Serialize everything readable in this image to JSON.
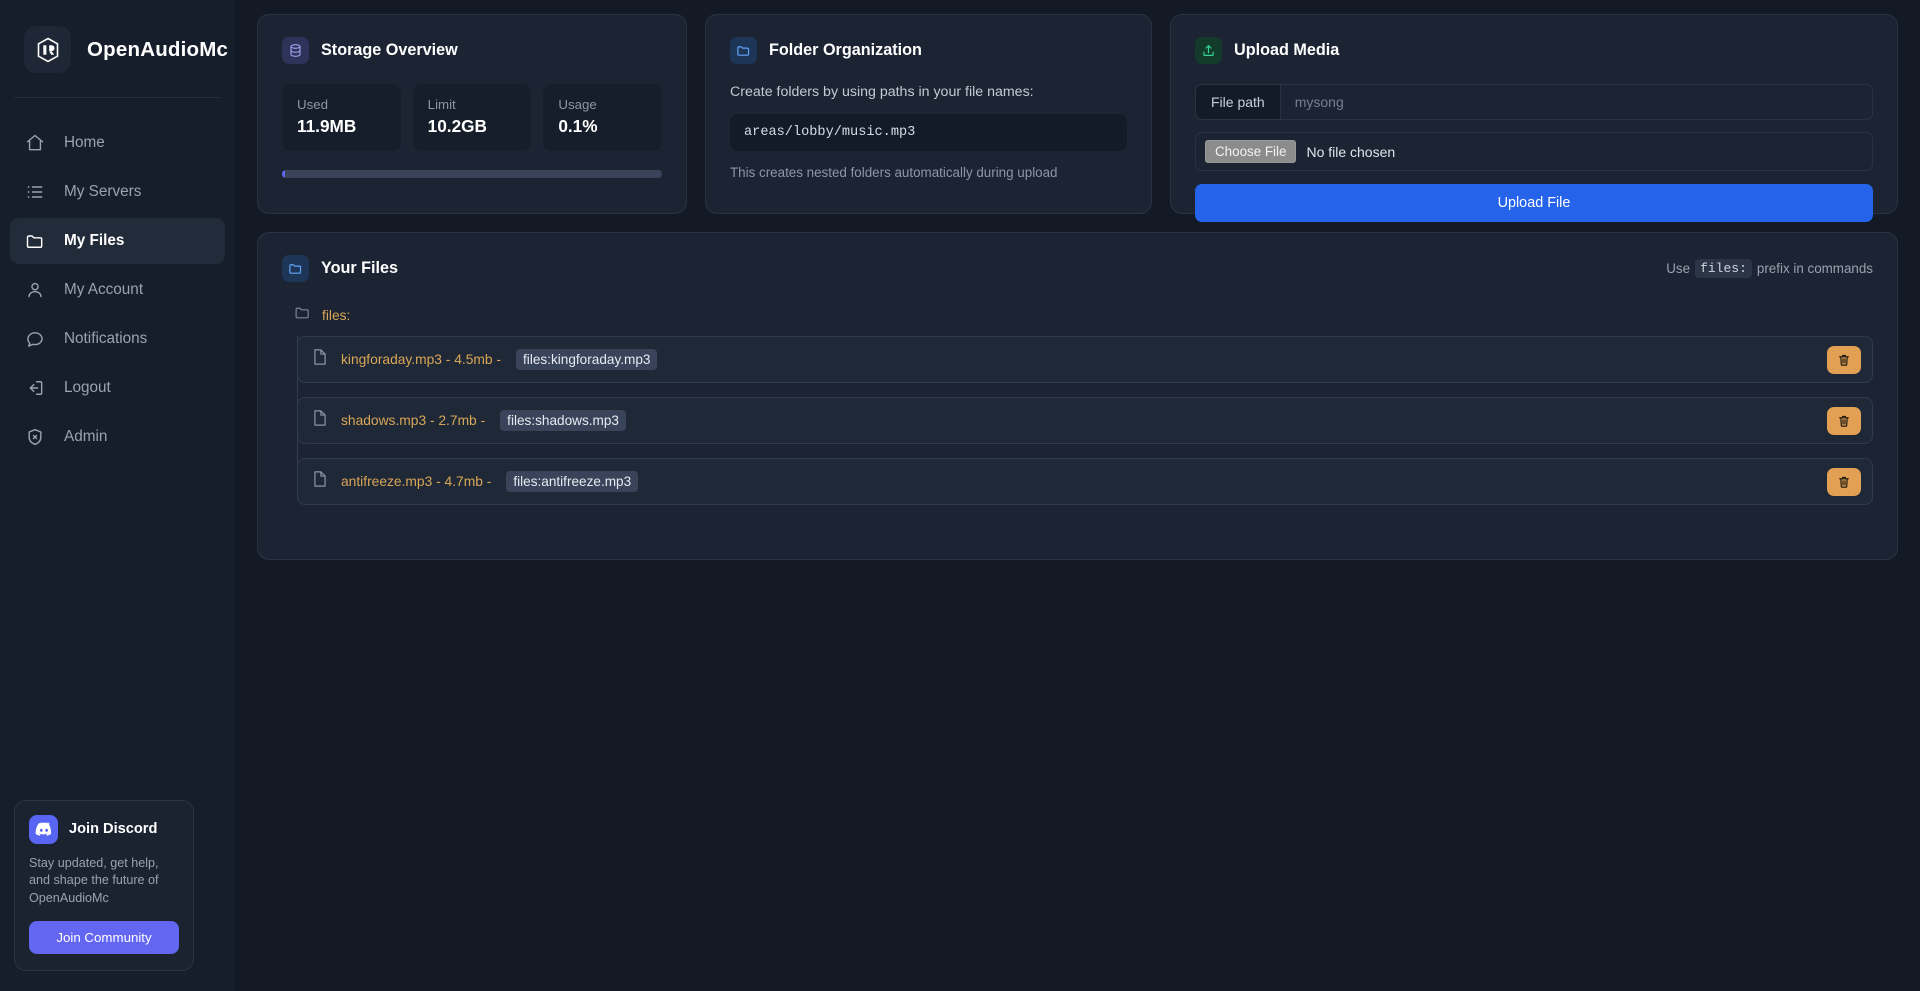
{
  "brand": {
    "name": "OpenAudioMc",
    "logo_icon": "openaudiomc-logo-icon"
  },
  "sidebar": {
    "items": [
      {
        "label": "Home",
        "icon": "home-icon",
        "active": false
      },
      {
        "label": "My Servers",
        "icon": "list-icon",
        "active": false
      },
      {
        "label": "My Files",
        "icon": "folder-icon",
        "active": true
      },
      {
        "label": "My Account",
        "icon": "user-icon",
        "active": false
      },
      {
        "label": "Notifications",
        "icon": "chat-bubble-icon",
        "active": false
      },
      {
        "label": "Logout",
        "icon": "logout-icon",
        "active": false
      },
      {
        "label": "Admin",
        "icon": "shield-icon",
        "active": false
      }
    ],
    "discord": {
      "title": "Join Discord",
      "icon": "discord-icon",
      "description": "Stay updated, get help, and shape the future of OpenAudioMc",
      "button_label": "Join Community",
      "accent_color": "#6366f1"
    }
  },
  "storage": {
    "title": "Storage Overview",
    "icon": "database-icon",
    "stats": [
      {
        "label": "Used",
        "value": "11.9MB"
      },
      {
        "label": "Limit",
        "value": "10.2GB"
      },
      {
        "label": "Usage",
        "value": "0.1%"
      }
    ],
    "progress_percent": 0.1,
    "progress_color": "#6366f1"
  },
  "folder_org": {
    "title": "Folder Organization",
    "icon": "folder-icon",
    "lead": "Create folders by using paths in your file names:",
    "example": "areas/lobby/music.mp3",
    "note": "This creates nested folders automatically during upload"
  },
  "upload": {
    "title": "Upload Media",
    "icon": "upload-icon",
    "path_addon_label": "File path",
    "path_placeholder": "mysong",
    "path_value": "",
    "choose_file_label": "Choose File",
    "no_file_label": "No file chosen",
    "submit_label": "Upload File",
    "submit_color": "#2563eb"
  },
  "your_files": {
    "title": "Your Files",
    "icon": "folder-icon",
    "hint_prefix": "Use",
    "hint_code": "files:",
    "hint_suffix": "prefix in commands",
    "root_folder": "files:",
    "root_folder_icon": "folder-open-icon",
    "files": [
      {
        "name": "kingforaday.mp3",
        "size": "4.5mb",
        "separator": "-",
        "reference": "files:kingforaday.mp3",
        "icon": "file-icon",
        "delete_icon": "trash-icon"
      },
      {
        "name": "shadows.mp3",
        "size": "2.7mb",
        "separator": "-",
        "reference": "files:shadows.mp3",
        "icon": "file-icon",
        "delete_icon": "trash-icon"
      },
      {
        "name": "antifreeze.mp3",
        "size": "4.7mb",
        "separator": "-",
        "reference": "files:antifreeze.mp3",
        "icon": "file-icon",
        "delete_icon": "trash-icon"
      }
    ],
    "delete_button_color": "#e2a055"
  }
}
